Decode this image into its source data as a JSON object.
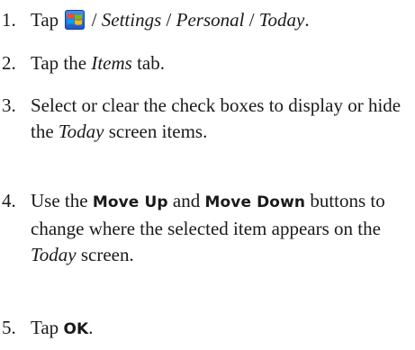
{
  "steps": [
    {
      "num": "1.",
      "pre": "Tap ",
      "icon": "windows-start-icon",
      "path": [
        " / ",
        "Settings",
        " / ",
        "Personal",
        " / ",
        "Today",
        "."
      ]
    },
    {
      "num": "2.",
      "pre": "Tap the ",
      "tab": "Items",
      "post": " tab."
    },
    {
      "num": "3.",
      "pre": "Select or clear the check boxes to display or hide the ",
      "screen": "Today",
      "post": " screen items."
    },
    {
      "num": "4.",
      "pre": "Use the ",
      "btn1": "Move Up",
      "mid": " and ",
      "btn2": "Move Down",
      "post1": " buttons to change where the selected item appears on the ",
      "screen": "Today",
      "post2": " screen."
    },
    {
      "num": "5.",
      "pre": "Tap ",
      "btn": "OK",
      "post": "."
    }
  ]
}
